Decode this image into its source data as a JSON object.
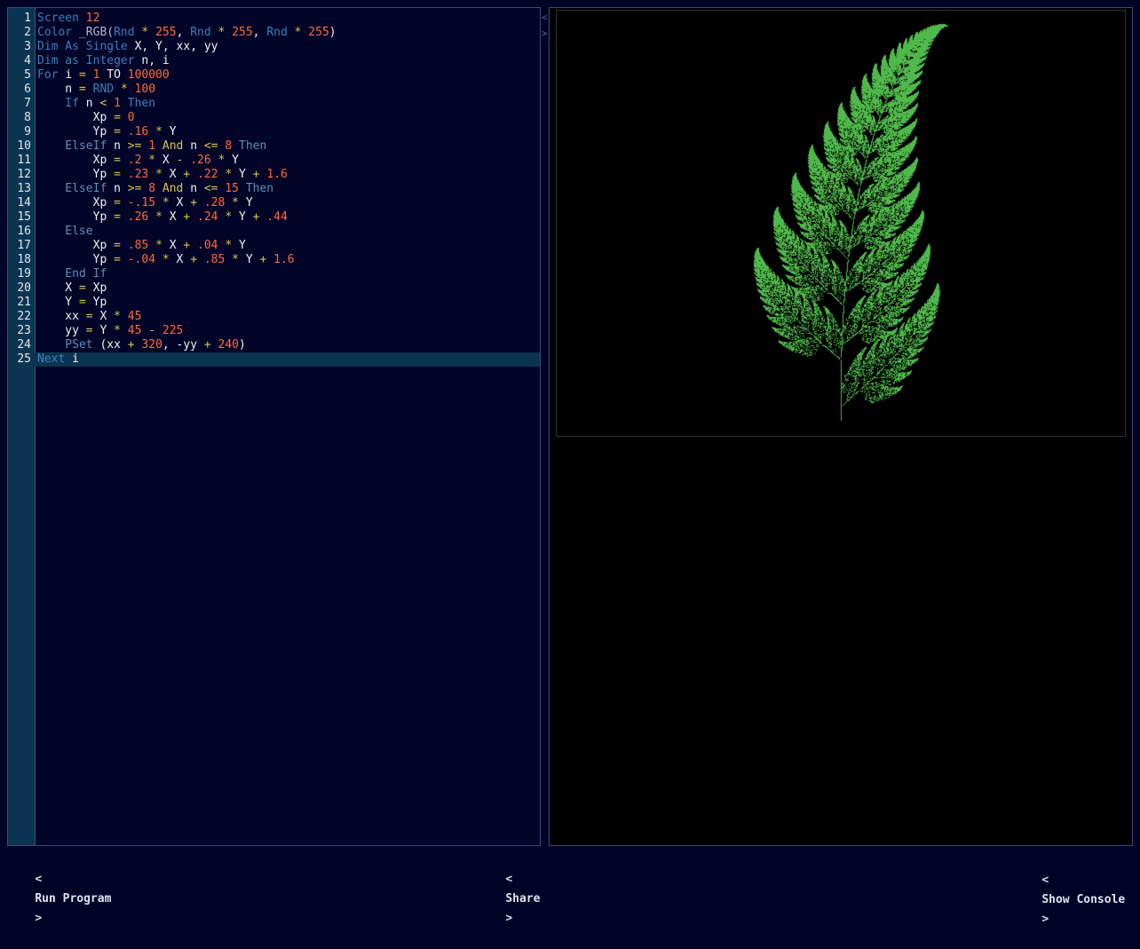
{
  "editor": {
    "current_line": 25,
    "lines": [
      {
        "n": "1",
        "t": [
          [
            "kw",
            "Screen "
          ],
          [
            "num",
            "12"
          ]
        ]
      },
      {
        "n": "2",
        "t": [
          [
            "kw",
            "Color "
          ],
          [
            "fn",
            "_RGB("
          ],
          [
            "kw",
            "Rnd "
          ],
          [
            "op",
            "* "
          ],
          [
            "num",
            "255"
          ],
          [
            "id",
            ", "
          ],
          [
            "kw",
            "Rnd "
          ],
          [
            "op",
            "* "
          ],
          [
            "num",
            "255"
          ],
          [
            "id",
            ", "
          ],
          [
            "kw",
            "Rnd "
          ],
          [
            "op",
            "* "
          ],
          [
            "num",
            "255"
          ],
          [
            "id",
            ")"
          ]
        ]
      },
      {
        "n": "3",
        "t": [
          [
            "kw",
            "Dim As Single "
          ],
          [
            "id",
            "X, Y, xx, yy"
          ]
        ]
      },
      {
        "n": "4",
        "t": [
          [
            "kw",
            "Dim as Integer "
          ],
          [
            "id",
            "n, i"
          ]
        ]
      },
      {
        "n": "5",
        "t": [
          [
            "kw",
            "For "
          ],
          [
            "id",
            "i "
          ],
          [
            "op",
            "= "
          ],
          [
            "num",
            "1 "
          ],
          [
            "id",
            "TO "
          ],
          [
            "num",
            "100000"
          ]
        ]
      },
      {
        "n": "6",
        "t": [
          [
            "id",
            "    n "
          ],
          [
            "op",
            "= "
          ],
          [
            "kw",
            "RND "
          ],
          [
            "op",
            "* "
          ],
          [
            "num",
            "100"
          ]
        ]
      },
      {
        "n": "7",
        "t": [
          [
            "kw",
            "    If "
          ],
          [
            "id",
            "n "
          ],
          [
            "op",
            "< "
          ],
          [
            "num",
            "1 "
          ],
          [
            "kw",
            "Then"
          ]
        ]
      },
      {
        "n": "8",
        "t": [
          [
            "id",
            "        Xp "
          ],
          [
            "op",
            "= "
          ],
          [
            "num",
            "0"
          ]
        ]
      },
      {
        "n": "9",
        "t": [
          [
            "id",
            "        Yp "
          ],
          [
            "op",
            "= "
          ],
          [
            "num",
            ".16 "
          ],
          [
            "op",
            "* "
          ],
          [
            "id",
            "Y"
          ]
        ]
      },
      {
        "n": "10",
        "t": [
          [
            "kw2",
            "    ElseIf "
          ],
          [
            "id",
            "n "
          ],
          [
            "op",
            ">= "
          ],
          [
            "num",
            "1 "
          ],
          [
            "op",
            "And "
          ],
          [
            "id",
            "n "
          ],
          [
            "op",
            "<= "
          ],
          [
            "num",
            "8 "
          ],
          [
            "kw2",
            "Then"
          ]
        ]
      },
      {
        "n": "11",
        "t": [
          [
            "id",
            "        Xp "
          ],
          [
            "op",
            "= "
          ],
          [
            "num",
            ".2 "
          ],
          [
            "op",
            "* "
          ],
          [
            "id",
            "X "
          ],
          [
            "op",
            "- "
          ],
          [
            "num",
            ".26 "
          ],
          [
            "op",
            "* "
          ],
          [
            "id",
            "Y"
          ]
        ]
      },
      {
        "n": "12",
        "t": [
          [
            "id",
            "        Yp "
          ],
          [
            "op",
            "= "
          ],
          [
            "num",
            ".23 "
          ],
          [
            "op",
            "* "
          ],
          [
            "id",
            "X "
          ],
          [
            "op",
            "+ "
          ],
          [
            "num",
            ".22 "
          ],
          [
            "op",
            "* "
          ],
          [
            "id",
            "Y "
          ],
          [
            "op",
            "+ "
          ],
          [
            "num",
            "1.6"
          ]
        ]
      },
      {
        "n": "13",
        "t": [
          [
            "kw2",
            "    ElseIf "
          ],
          [
            "id",
            "n "
          ],
          [
            "op",
            ">= "
          ],
          [
            "num",
            "8 "
          ],
          [
            "op",
            "And "
          ],
          [
            "id",
            "n "
          ],
          [
            "op",
            "<= "
          ],
          [
            "num",
            "15 "
          ],
          [
            "kw2",
            "Then"
          ]
        ]
      },
      {
        "n": "14",
        "t": [
          [
            "id",
            "        Xp "
          ],
          [
            "op",
            "= "
          ],
          [
            "num",
            "-.15 "
          ],
          [
            "op",
            "* "
          ],
          [
            "id",
            "X "
          ],
          [
            "op",
            "+ "
          ],
          [
            "num",
            ".28 "
          ],
          [
            "op",
            "* "
          ],
          [
            "id",
            "Y"
          ]
        ]
      },
      {
        "n": "15",
        "t": [
          [
            "id",
            "        Yp "
          ],
          [
            "op",
            "= "
          ],
          [
            "num",
            ".26 "
          ],
          [
            "op",
            "* "
          ],
          [
            "id",
            "X "
          ],
          [
            "op",
            "+ "
          ],
          [
            "num",
            ".24 "
          ],
          [
            "op",
            "* "
          ],
          [
            "id",
            "Y "
          ],
          [
            "op",
            "+ "
          ],
          [
            "num",
            ".44"
          ]
        ]
      },
      {
        "n": "16",
        "t": [
          [
            "kw2",
            "    Else"
          ]
        ]
      },
      {
        "n": "17",
        "t": [
          [
            "id",
            "        Xp "
          ],
          [
            "op",
            "= "
          ],
          [
            "num",
            ".85 "
          ],
          [
            "op",
            "* "
          ],
          [
            "id",
            "X "
          ],
          [
            "op",
            "+ "
          ],
          [
            "num",
            ".04 "
          ],
          [
            "op",
            "* "
          ],
          [
            "id",
            "Y"
          ]
        ]
      },
      {
        "n": "18",
        "t": [
          [
            "id",
            "        Yp "
          ],
          [
            "op",
            "= "
          ],
          [
            "num",
            "-.04 "
          ],
          [
            "op",
            "* "
          ],
          [
            "id",
            "X "
          ],
          [
            "op",
            "+ "
          ],
          [
            "num",
            ".85 "
          ],
          [
            "op",
            "* "
          ],
          [
            "id",
            "Y "
          ],
          [
            "op",
            "+ "
          ],
          [
            "num",
            "1.6"
          ]
        ]
      },
      {
        "n": "19",
        "t": [
          [
            "kw2",
            "    End If"
          ]
        ]
      },
      {
        "n": "20",
        "t": [
          [
            "id",
            "    X "
          ],
          [
            "op",
            "= "
          ],
          [
            "id",
            "Xp"
          ]
        ]
      },
      {
        "n": "21",
        "t": [
          [
            "id",
            "    Y "
          ],
          [
            "op",
            "= "
          ],
          [
            "id",
            "Yp"
          ]
        ]
      },
      {
        "n": "22",
        "t": [
          [
            "id",
            "    xx "
          ],
          [
            "op",
            "= "
          ],
          [
            "id",
            "X "
          ],
          [
            "op",
            "* "
          ],
          [
            "num",
            "45"
          ]
        ]
      },
      {
        "n": "23",
        "t": [
          [
            "id",
            "    yy "
          ],
          [
            "op",
            "= "
          ],
          [
            "id",
            "Y "
          ],
          [
            "op",
            "* "
          ],
          [
            "num",
            "45 "
          ],
          [
            "op",
            "- "
          ],
          [
            "num",
            "225"
          ]
        ]
      },
      {
        "n": "24",
        "t": [
          [
            "kw2",
            "    PSet "
          ],
          [
            "id",
            "(xx "
          ],
          [
            "op",
            "+ "
          ],
          [
            "num",
            "320"
          ],
          [
            "id",
            ", -yy "
          ],
          [
            "op",
            "+ "
          ],
          [
            "num",
            "240"
          ],
          [
            "id",
            ")"
          ]
        ]
      },
      {
        "n": "25",
        "t": [
          [
            "kw",
            "Next "
          ],
          [
            "id",
            "i"
          ]
        ]
      }
    ]
  },
  "splitter": {
    "collapse_left": "<",
    "expand_right": ">"
  },
  "output": {
    "fern_color": "#4fb84a",
    "background": "#000000",
    "points": 100000
  },
  "footer": {
    "run_label": "Run Program",
    "share_label": "Share",
    "console_label": "Show Console",
    "arrow_left": "<",
    "arrow_right": ">"
  }
}
